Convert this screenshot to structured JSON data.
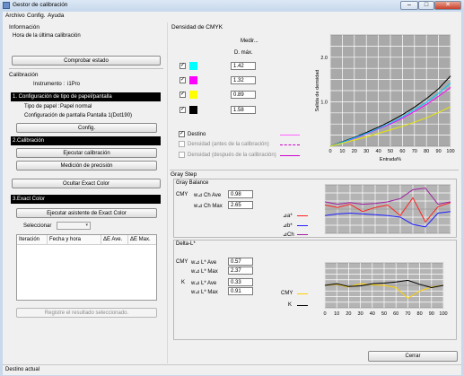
{
  "window": {
    "title": "Gestor de calibración",
    "minimize": "–",
    "maximize": "□",
    "close": "✕"
  },
  "menu": [
    "Archivo",
    "Config.",
    "Ayuda"
  ],
  "left": {
    "info_title": "Información",
    "last_cal_label": "Hora de la última calibración",
    "check_status": "Comprobar estado",
    "calibration_title": "Calibración",
    "instrument_label": "Instrumento :",
    "instrument_value": "i1Pro",
    "paper_header": "1. Configuración de tipo de papel/pantalla",
    "paper_type_label": "Tipo de papel :",
    "paper_type_value": "Papel normal",
    "screen_config_label": "Configuración de pantalla :",
    "screen_config_value": "Pantalla 1(Dot190)",
    "config_button": "Config.",
    "calibration_header": "2.Calibración",
    "run_calibration": "Ejecutar calibración",
    "precision_measure": "Medición de precisión",
    "hide_exact_color": "Ocultar Exact Color",
    "exact_color_header": "3.Exact Color",
    "exact_wizard": "Ejecutar asistente de Exact Color",
    "select_label": "Seleccionar",
    "table_headers": [
      "Iteración",
      "Fecha y hora",
      "ΔE Ave.",
      "ΔE Max."
    ],
    "register_result": "Registre el resultado seleccionado."
  },
  "cmyk": {
    "title": "Densidad de CMYK",
    "measure": "Medir...",
    "dmax_label": "D. máx.",
    "channels": [
      {
        "name": "C",
        "color": "#00ffff",
        "value": "1.42",
        "checked": true
      },
      {
        "name": "M",
        "color": "#ff00ff",
        "value": "1.32",
        "checked": true
      },
      {
        "name": "Y",
        "color": "#ffff00",
        "value": "0.89",
        "checked": true
      },
      {
        "name": "K",
        "color": "#000000",
        "value": "1.58",
        "checked": true
      }
    ],
    "legend": [
      {
        "label": "Destino",
        "checked": true,
        "enabled": true,
        "color": "#ff66ff",
        "style": "solid"
      },
      {
        "label": "Densidad (antes de la calibración)",
        "checked": false,
        "enabled": false,
        "color": "#cc00cc",
        "style": "dashed"
      },
      {
        "label": "Densidad (después de la calibración)",
        "checked": false,
        "enabled": false,
        "color": "#cc00cc",
        "style": "solid"
      }
    ]
  },
  "gray_step": {
    "title": "Gray Step",
    "gray_balance_title": "Gray Balance",
    "cmy_label": "CMY",
    "ch_ave_label": "w⊿ Ch Ave",
    "ch_ave_value": "0.98",
    "ch_max_label": "w⊿ Ch Max",
    "ch_max_value": "2.65",
    "legend": [
      {
        "label": "⊿a*",
        "color": "#ff2020"
      },
      {
        "label": "⊿b*",
        "color": "#2020ff"
      },
      {
        "label": "⊿Ch",
        "color": "#a020a0"
      }
    ],
    "delta_l_title": "Delta-L*",
    "cmy_l_ave_label": "w⊿ L* Ave",
    "cmy_l_ave_value": "0.57",
    "cmy_l_max_label": "w⊿ L* Max",
    "cmy_l_max_value": "2.37",
    "k_label": "K",
    "k_l_ave_label": "w⊿ L* Ave",
    "k_l_ave_value": "0.33",
    "k_l_max_label": "w⊿ L* Max",
    "k_l_max_value": "0.91",
    "delta_legend": [
      {
        "label": "CMY",
        "color": "#ffd000"
      },
      {
        "label": "K",
        "color": "#000000"
      }
    ]
  },
  "close_button": "Cerrar",
  "status": "Destino actual",
  "chart_data": [
    {
      "type": "line",
      "title": "",
      "xlabel": "Entrada%",
      "ylabel": "Salida de densidad",
      "x": [
        0,
        10,
        20,
        30,
        40,
        50,
        60,
        70,
        80,
        90,
        100
      ],
      "xlim": [
        0,
        100
      ],
      "ylim": [
        0,
        2.5
      ],
      "yticks": [
        "1.0",
        "2.0"
      ],
      "grid": true,
      "series": [
        {
          "color": "#000000",
          "values": [
            0,
            0.1,
            0.2,
            0.31,
            0.43,
            0.56,
            0.71,
            0.88,
            1.07,
            1.29,
            1.58
          ]
        },
        {
          "color": "#ff00ff",
          "values": [
            0,
            0.09,
            0.18,
            0.28,
            0.39,
            0.5,
            0.63,
            0.78,
            0.94,
            1.12,
            1.32
          ]
        },
        {
          "color": "#00c8ff",
          "values": [
            0,
            0.09,
            0.19,
            0.29,
            0.4,
            0.52,
            0.66,
            0.82,
            0.99,
            1.19,
            1.42
          ]
        },
        {
          "color": "#e8e800",
          "values": [
            0,
            0.07,
            0.14,
            0.21,
            0.29,
            0.37,
            0.45,
            0.54,
            0.64,
            0.76,
            0.89
          ]
        }
      ]
    },
    {
      "type": "line",
      "title": "",
      "x": [
        0,
        10,
        20,
        30,
        40,
        50,
        60,
        70,
        80,
        90,
        100
      ],
      "xlim": [
        0,
        100
      ],
      "ylim": [
        -3,
        3
      ],
      "grid": true,
      "series": [
        {
          "color": "#ff2020",
          "values": [
            0.5,
            0.2,
            0.6,
            -0.3,
            0.2,
            0.5,
            -0.8,
            1.4,
            -1.6,
            0.3,
            0.8
          ]
        },
        {
          "color": "#2020ff",
          "values": [
            -0.8,
            -0.6,
            -0.5,
            -0.6,
            -0.7,
            -0.8,
            -1.0,
            -1.9,
            -2.2,
            -0.5,
            -0.3
          ]
        },
        {
          "color": "#a020a0",
          "values": [
            0.9,
            0.6,
            0.8,
            0.6,
            0.7,
            0.9,
            1.3,
            2.4,
            2.6,
            0.6,
            0.9
          ]
        }
      ]
    },
    {
      "type": "line",
      "title": "",
      "x": [
        0,
        10,
        20,
        30,
        40,
        50,
        60,
        70,
        80,
        90,
        100
      ],
      "xtick_labels": [
        "0",
        "10",
        "20",
        "30",
        "40",
        "50",
        "60",
        "70",
        "80",
        "90",
        "100"
      ],
      "xlim": [
        0,
        100
      ],
      "ylim": [
        -4,
        4
      ],
      "grid": true,
      "series": [
        {
          "color": "#ffd000",
          "values": [
            0,
            0.2,
            -0.3,
            0.3,
            0.1,
            0,
            -0.4,
            -2.3,
            -1.0,
            -0.3,
            0
          ]
        },
        {
          "color": "#000000",
          "values": [
            0,
            0.3,
            -0.2,
            -0.1,
            0.3,
            0.4,
            0.6,
            0.9,
            0.2,
            -0.4,
            0
          ]
        }
      ]
    }
  ]
}
